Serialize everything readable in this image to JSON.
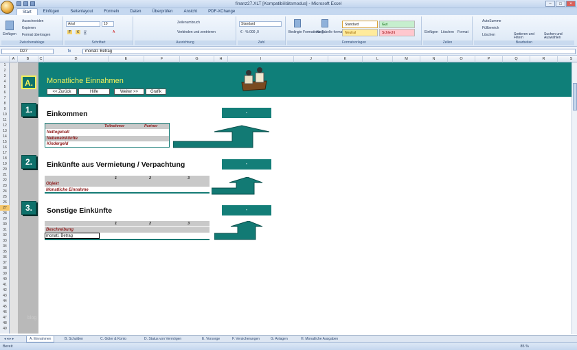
{
  "window": {
    "title": "finanz27.XLT  [Kompatibilitätsmodus]  -  Microsoft Excel"
  },
  "tabs": [
    "Start",
    "Einfügen",
    "Seitenlayout",
    "Formeln",
    "Daten",
    "Überprüfen",
    "Ansicht",
    "PDF-XChange"
  ],
  "ribbon": {
    "clipboard": {
      "paste": "Einfügen",
      "cut": "Ausschneiden",
      "copy": "Kopieren",
      "format": "Format übertragen",
      "label": "Zwischenablage"
    },
    "font": {
      "name": "Arial",
      "size": "10",
      "label": "Schriftart"
    },
    "align": {
      "wrap": "Zeilenumbruch",
      "merge": "Verbinden und zentrieren",
      "label": "Ausrichtung"
    },
    "number": {
      "format": "Standard",
      "label": "Zahl"
    },
    "styles": {
      "cond": "Bedingte Formatierung",
      "table": "Als Tabelle formatieren",
      "standard": "Standard",
      "gut": "Gut",
      "neutral": "Neutral",
      "schlecht": "Schlecht",
      "label": "Formatvorlagen"
    },
    "cells": {
      "insert": "Einfügen",
      "delete": "Löschen",
      "format": "Format",
      "label": "Zellen"
    },
    "edit": {
      "autosum": "AutoSumme",
      "fill": "Füllbereich",
      "clear": "Löschen",
      "sort": "Sortieren und Filtern",
      "find": "Suchen und Auswählen",
      "label": "Bearbeiten"
    }
  },
  "formula_bar": {
    "cell": "D27",
    "fx": "fx",
    "content": "monatl. Betrag"
  },
  "columns": [
    "A",
    "B",
    "C",
    "D",
    "E",
    "F",
    "G",
    "H",
    "I",
    "J",
    "K",
    "L",
    "M",
    "N",
    "O",
    "P",
    "Q",
    "R",
    "S"
  ],
  "rows": [
    "1",
    "2",
    "3",
    "4",
    "5",
    "6",
    "7",
    "8",
    "9",
    "10",
    "11",
    "12",
    "13",
    "14",
    "15",
    "16",
    "17",
    "18",
    "19",
    "20",
    "21",
    "22",
    "23",
    "24",
    "25",
    "26",
    "27",
    "28",
    "29",
    "30",
    "31",
    "32",
    "33",
    "34",
    "35",
    "36",
    "37",
    "38",
    "39",
    "40",
    "41",
    "42",
    "43",
    "44",
    "45",
    "46",
    "47",
    "48",
    "49"
  ],
  "sheet": {
    "section_a": {
      "badge": "A.",
      "title": "Monatliche Einnahmen"
    },
    "nav": [
      "<< Zurück",
      "Hilfe",
      "Weiter >>",
      "Grafik"
    ],
    "s1": {
      "badge": "1.",
      "title": "Einkommen",
      "total": "-",
      "col1": "Teilnehmer",
      "col2": "Partner",
      "rows": [
        "Nettogehalt",
        "Nebeneinkünfte",
        "Kindergeld"
      ]
    },
    "s2": {
      "badge": "2.",
      "title": "Einkünfte aus Vermietung / Verpachtung",
      "total": "-",
      "cols": [
        "1",
        "2",
        "3"
      ],
      "rows": [
        "Objekt",
        "Monatliche Einnahme"
      ]
    },
    "s3": {
      "badge": "3.",
      "title": "Sonstige Einkünfte",
      "total": "-",
      "cols": [
        "1",
        "2",
        "3"
      ],
      "rows": [
        "Beschreibung",
        "monatl. Betrag"
      ]
    }
  },
  "sheet_tabs": [
    "A. Einnahmen",
    "B. Schulden",
    "C. Güter & Konto",
    "D. Status von Vermögen",
    "E. Vorsorge",
    "F. Versicherungen",
    "G. Anlagen",
    "H. Monatliche Ausgaben"
  ],
  "status": {
    "ready": "Bereit",
    "zoom": "85 %"
  },
  "watermark": "blog"
}
